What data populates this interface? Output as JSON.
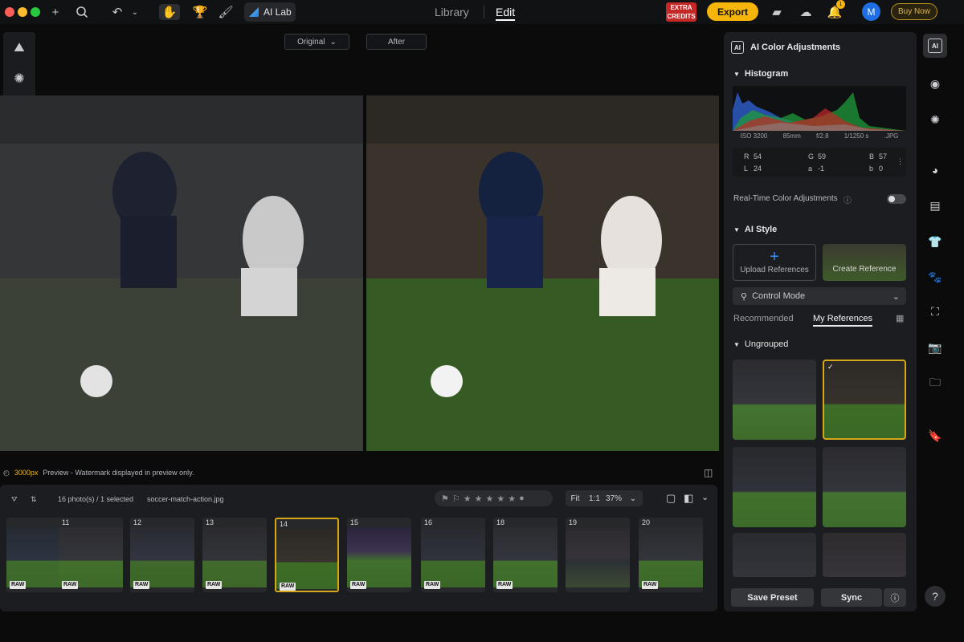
{
  "topbar": {
    "tabs": {
      "library": "Library",
      "edit": "Edit"
    },
    "ai_lab": "AI Lab",
    "extra_credits": "EXTRA CREDITS",
    "export": "Export",
    "notification_count": "1",
    "avatar": "M",
    "buy_now": "Buy Now"
  },
  "viewer": {
    "original_label": "Original",
    "after_label": "After",
    "resolution": "3000px",
    "watermark_note": "Preview - Watermark displayed in preview only."
  },
  "filmstrip": {
    "count_text": "16 photo(s) / 1 selected",
    "filename": "soccer-match-action.jpg",
    "zoom": {
      "fit": "Fit",
      "one_to_one": "1:1",
      "percent": "37%"
    },
    "thumbs": [
      {
        "num": "",
        "raw": "RAW"
      },
      {
        "num": "11",
        "raw": "RAW"
      },
      {
        "num": "12",
        "raw": "RAW"
      },
      {
        "num": "13",
        "raw": "RAW"
      },
      {
        "num": "14",
        "raw": "RAW"
      },
      {
        "num": "15",
        "raw": "RAW"
      },
      {
        "num": "16",
        "raw": "RAW"
      },
      {
        "num": "18",
        "raw": "RAW"
      },
      {
        "num": "19",
        "raw": ""
      },
      {
        "num": "20",
        "raw": "RAW"
      }
    ]
  },
  "panel": {
    "title": "AI Color Adjustments",
    "histogram": {
      "label": "Histogram",
      "iso": "ISO 3200",
      "focal": "85mm",
      "aperture": "f/2.8",
      "shutter": "1/1250 s",
      "format": ".JPG",
      "r": "54",
      "g": "59",
      "b": "57",
      "l": "24",
      "a": "-1",
      "b2": "0"
    },
    "realtime_label": "Real-Time Color Adjustments",
    "ai_style_label": "AI Style",
    "upload_label": "Upload References",
    "create_label": "Create Reference",
    "control_mode": "Control Mode",
    "tab_recommended": "Recommended",
    "tab_my_refs": "My References",
    "group_label": "Ungrouped",
    "save_preset": "Save Preset",
    "sync": "Sync"
  },
  "colors": {
    "accent": "#f5b50a",
    "selected_border": "#d5a719",
    "blue": "#3a8ef5"
  }
}
